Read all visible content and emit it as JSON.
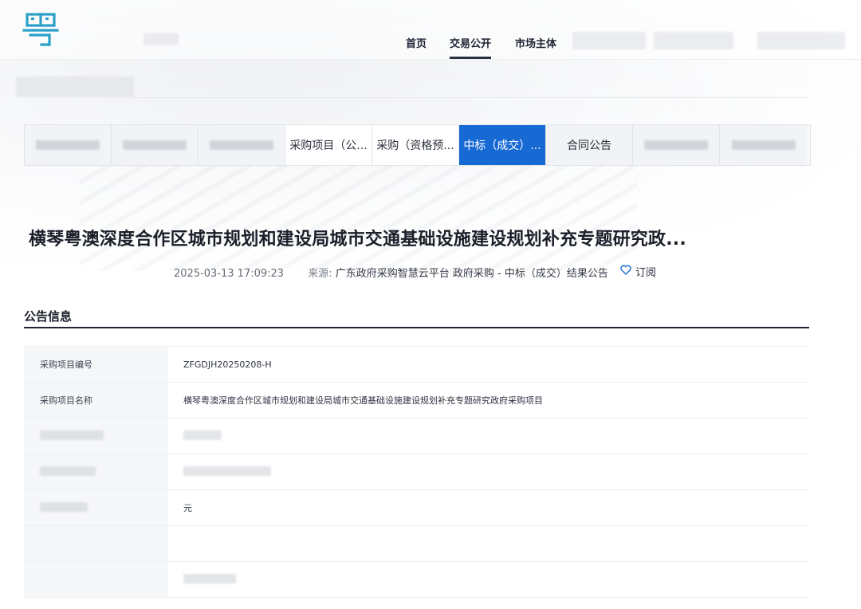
{
  "header": {
    "nav": [
      {
        "label": "首页",
        "active": false
      },
      {
        "label": "交易公开",
        "active": true
      },
      {
        "label": "市场主体",
        "active": false
      }
    ]
  },
  "tabs": [
    {
      "label": "",
      "state": "blurred"
    },
    {
      "label": "",
      "state": "blurred"
    },
    {
      "label": "",
      "state": "blurred"
    },
    {
      "label": "采购项目（公...",
      "state": "normal"
    },
    {
      "label": "采购（资格预...",
      "state": "normal"
    },
    {
      "label": "中标（成交）...",
      "state": "active"
    },
    {
      "label": "合同公告",
      "state": "normal"
    },
    {
      "label": "",
      "state": "blurred"
    },
    {
      "label": "",
      "state": "blurred"
    }
  ],
  "article": {
    "title": "横琴粤澳深度合作区城市规划和建设局城市交通基础设施建设规划补充专题研究政...",
    "date": "2025-03-13 17:09:23",
    "source_label": "来源:",
    "source": "广东政府采购智慧云平台 政府采购 - 中标（成交）结果公告",
    "subscribe_label": "订阅"
  },
  "section": {
    "title": "公告信息"
  },
  "info_rows": [
    {
      "key": "采购项目编号",
      "value": "ZFGDJH20250208-H"
    },
    {
      "key": "采购项目名称",
      "value": "横琴粤澳深度合作区城市规划和建设局城市交通基础设施建设规划补充专题研究政府采购项目"
    },
    {
      "key": "",
      "value": ""
    },
    {
      "key": "",
      "value": ""
    },
    {
      "key": "",
      "value": "元"
    },
    {
      "key": "",
      "value": ""
    },
    {
      "key": "",
      "value": ""
    }
  ],
  "colors": {
    "accent": "#1769d3",
    "title_text": "#1b1f29",
    "logo": "#2aa0c9"
  },
  "icons": {
    "logo": "yue-logo-icon",
    "subscribe": "heart-icon"
  }
}
